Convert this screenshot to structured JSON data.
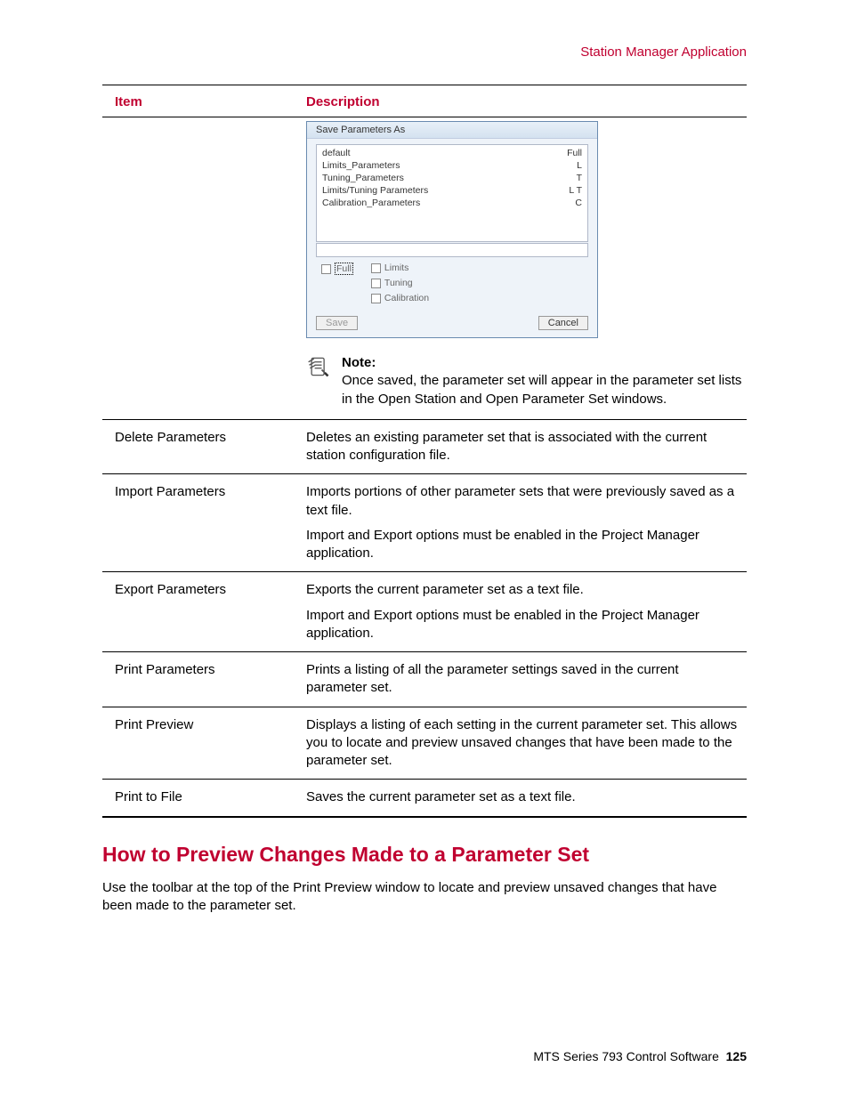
{
  "header": {
    "app_title": "Station Manager Application"
  },
  "table": {
    "col_item": "Item",
    "col_desc": "Description"
  },
  "dialog": {
    "title": "Save Parameters As",
    "rows": [
      {
        "name": "default",
        "tag": "Full"
      },
      {
        "name": "Limits_Parameters",
        "tag": "L"
      },
      {
        "name": "Tuning_Parameters",
        "tag": "T"
      },
      {
        "name": "Limits/Tuning Parameters",
        "tag": "L T"
      },
      {
        "name": "Calibration_Parameters",
        "tag": "C"
      }
    ],
    "chk_full": "Full",
    "chk_limits": "Limits",
    "chk_tuning": "Tuning",
    "chk_calibration": "Calibration",
    "save": "Save",
    "cancel": "Cancel"
  },
  "note": {
    "label": "Note:",
    "text": "Once saved, the parameter set will appear in the parameter set lists in the Open Station and Open Parameter Set windows."
  },
  "rows": {
    "r1": {
      "item": "Delete Parameters",
      "d1": "Deletes an existing parameter set that is associated with the current station configuration file."
    },
    "r2": {
      "item": "Import Parameters",
      "d1": "Imports portions of other parameter sets that were previously saved as a text file.",
      "d2": "Import and Export options must be enabled in the Project Manager application."
    },
    "r3": {
      "item": "Export Parameters",
      "d1": "Exports the current parameter set as a text file.",
      "d2": "Import and Export options must be enabled in the Project Manager application."
    },
    "r4": {
      "item": "Print Parameters",
      "d1": "Prints a listing of all the parameter settings saved in the current parameter set."
    },
    "r5": {
      "item": "Print Preview",
      "d1": "Displays a listing of each setting in the current parameter set. This allows you to locate and preview unsaved changes that have been made to the parameter set."
    },
    "r6": {
      "item": "Print to File",
      "d1": "Saves the current parameter set as a text file."
    }
  },
  "section": {
    "heading": "How to Preview Changes Made to a Parameter Set",
    "body": "Use the toolbar at the top of the Print Preview window to locate and preview unsaved changes that have been made to the parameter set."
  },
  "footer": {
    "product": "MTS Series 793 Control Software",
    "page": "125"
  }
}
